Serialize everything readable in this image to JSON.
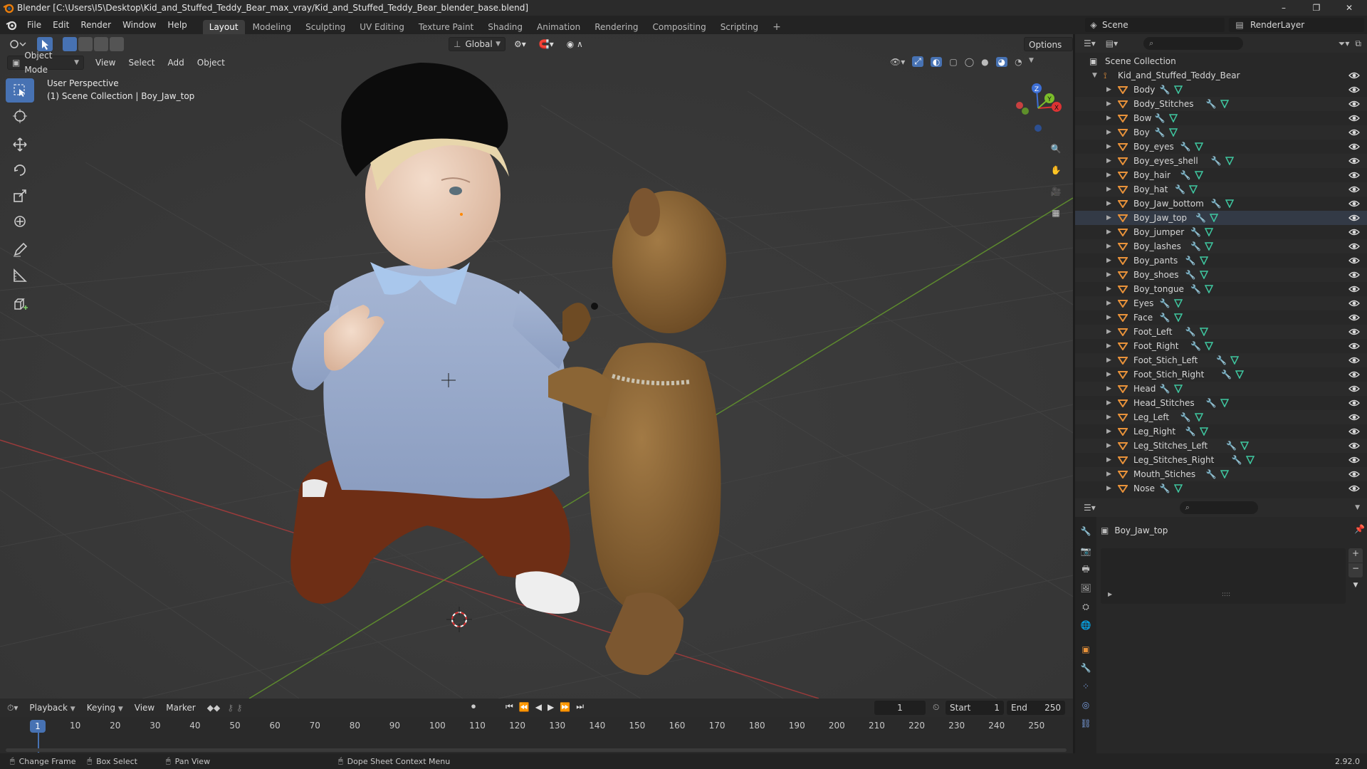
{
  "window": {
    "title": "Blender [C:\\Users\\I5\\Desktop\\Kid_and_Stuffed_Teddy_Bear_max_vray/Kid_and_Stuffed_Teddy_Bear_blender_base.blend]",
    "minimize": "–",
    "maximize": "❐",
    "close": "✕"
  },
  "menus": [
    "File",
    "Edit",
    "Render",
    "Window",
    "Help"
  ],
  "workspaces": [
    {
      "label": "Layout",
      "active": true
    },
    {
      "label": "Modeling",
      "active": false
    },
    {
      "label": "Sculpting",
      "active": false
    },
    {
      "label": "UV Editing",
      "active": false
    },
    {
      "label": "Texture Paint",
      "active": false
    },
    {
      "label": "Shading",
      "active": false
    },
    {
      "label": "Animation",
      "active": false
    },
    {
      "label": "Rendering",
      "active": false
    },
    {
      "label": "Compositing",
      "active": false
    },
    {
      "label": "Scripting",
      "active": false
    }
  ],
  "scene": {
    "label": "Scene",
    "render_layer": "RenderLayer"
  },
  "viewport": {
    "transform_orientation": "Global",
    "options": "Options",
    "mode": "Object Mode",
    "menus": [
      "View",
      "Select",
      "Add",
      "Object"
    ],
    "overlay_line1": "User Perspective",
    "overlay_line2": "(1) Scene Collection | Boy_Jaw_top",
    "gizmo_z": "Z",
    "gizmo_y": "Y",
    "gizmo_x": "X"
  },
  "outliner": {
    "root": "Scene Collection",
    "collection": "Kid_and_Stuffed_Teddy_Bear",
    "selected": "Boy_Jaw_top",
    "items": [
      "Body",
      "Body_Stitches",
      "Bow",
      "Boy",
      "Boy_eyes",
      "Boy_eyes_shell",
      "Boy_hair",
      "Boy_hat",
      "Boy_Jaw_bottom",
      "Boy_Jaw_top",
      "Boy_jumper",
      "Boy_lashes",
      "Boy_pants",
      "Boy_shoes",
      "Boy_tongue",
      "Eyes",
      "Face",
      "Foot_Left",
      "Foot_Right",
      "Foot_Stich_Left",
      "Foot_Stich_Right",
      "Head",
      "Head_Stitches",
      "Leg_Left",
      "Leg_Right",
      "Leg_Stitches_Left",
      "Leg_Stitches_Right",
      "Mouth_Stiches",
      "Nose"
    ]
  },
  "properties": {
    "object_name": "Boy_Jaw_top",
    "list_handle": "::::"
  },
  "timeline": {
    "menus": [
      "Playback",
      "Keying",
      "View",
      "Marker"
    ],
    "current_frame": "1",
    "start_label": "Start",
    "start": "1",
    "end_label": "End",
    "end": "250",
    "ticks": [
      "10",
      "20",
      "30",
      "40",
      "50",
      "60",
      "70",
      "80",
      "90",
      "100",
      "110",
      "120",
      "130",
      "140",
      "150",
      "160",
      "170",
      "180",
      "190",
      "200",
      "210",
      "220",
      "230",
      "240",
      "250"
    ]
  },
  "status": {
    "change_frame": "Change Frame",
    "box_select": "Box Select",
    "pan_view": "Pan View",
    "context_menu": "Dope Sheet Context Menu",
    "version": "2.92.0"
  },
  "colors": {
    "accent": "#4772b3",
    "object_orange": "#e8923a",
    "mesh_green": "#3fc7a0",
    "modifier_blue": "#7a9fe0"
  }
}
